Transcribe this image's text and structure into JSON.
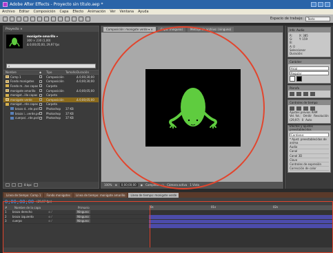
{
  "app": {
    "title": "Adobe After Effects - Proyecto sin título.aep *"
  },
  "menu": [
    "Archivo",
    "Editar",
    "Composición",
    "Capa",
    "Efecto",
    "Animación",
    "Ver",
    "Ventana",
    "Ayuda"
  ],
  "toolbar": {
    "workspace_label": "Espacio de trabajo:",
    "workspace_value": "Texto"
  },
  "project": {
    "tab": "Proyecto ×",
    "selected_name": "monigote-amarillo ▾",
    "selected_size": "300 × 230 (1,00)",
    "selected_duration": "Δ 0;00;05;00, 29,97 fps",
    "columns": [
      "Nombre",
      "Tipo",
      "Tamaño",
      "Duración"
    ],
    "items": [
      {
        "name": "Comp 1",
        "type": "Composición",
        "size": "",
        "duration": "Δ 0;00;30;00",
        "icon": "comp",
        "indent": false,
        "selected": false
      },
      {
        "name": "Fondo monigotes",
        "type": "Composición",
        "size": "",
        "duration": "Δ 0;00;30;00",
        "icon": "comp",
        "indent": false,
        "selected": false
      },
      {
        "name": "Fondo m...tos capas",
        "type": "Carpeta",
        "size": "",
        "duration": "",
        "icon": "folder",
        "indent": false,
        "selected": false
      },
      {
        "name": "monigote amarillo",
        "type": "Composición",
        "size": "",
        "duration": "Δ 0;00;05;00",
        "icon": "comp",
        "indent": false,
        "selected": false
      },
      {
        "name": "monigot...illo capas",
        "type": "Carpeta",
        "size": "",
        "duration": "",
        "icon": "folder",
        "indent": false,
        "selected": false
      },
      {
        "name": "monigote verde",
        "type": "Composición",
        "size": "",
        "duration": "Δ 0;00;05;00",
        "icon": "comp",
        "indent": false,
        "selected": true
      },
      {
        "name": "monigot...rde capas",
        "type": "Carpeta",
        "size": "",
        "duration": "",
        "icon": "folder",
        "indent": false,
        "selected": false
      },
      {
        "name": "brazo d...rde.psd",
        "type": "Photoshop",
        "size": "37 KB",
        "duration": "",
        "icon": "psd",
        "indent": true,
        "selected": false
      },
      {
        "name": "brazo i...verde.psd",
        "type": "Photoshop",
        "size": "37 KB",
        "duration": "",
        "icon": "psd",
        "indent": true,
        "selected": false
      },
      {
        "name": "cuerpo/...rde.psd",
        "type": "Photoshop",
        "size": "37 KB",
        "duration": "",
        "icon": "psd",
        "indent": true,
        "selected": false
      }
    ],
    "footer_bits": "8 bpc"
  },
  "comp": {
    "tabs": [
      {
        "label": "Composición: monigote verde ▾ ×",
        "active": true
      },
      {
        "label": "Capa: (ninguna)",
        "active": false
      },
      {
        "label": "Metraje de archivo: (ninguno)",
        "active": false
      }
    ],
    "zoom": "100%",
    "timecode": "0;00;00;00",
    "resolution": "Completa",
    "camera": "Cámara activa",
    "view": "1 Vista"
  },
  "right": {
    "info_tab": "Info",
    "audio_tab": "Audio",
    "info_lines": [
      "R:",
      "G:",
      "B:",
      "A: 0",
      "X: 385",
      "Y: 159"
    ],
    "info_footer": [
      "Seleccionar",
      "Duración:"
    ],
    "char_tab": "Carácter",
    "font": "Arial",
    "style": "Regular",
    "para_tab": "Párrafo",
    "anim_tab": "Controles de tiempo",
    "preview_label": "Ajustes previos RAM",
    "fps_label": "Vel. fot.:",
    "skip_label": "Omitir",
    "res_label": "Resolución",
    "fps_value": "(29,97)",
    "skip_value": "0",
    "res_value": "Auto",
    "fx_tab": "Efectos y ajustes preestablecidos",
    "fx_search": "Contiene:",
    "fx_items": [
      "* Ajust. preestablecidos de anima",
      "Audio",
      "Canal",
      "Canal 3D",
      "Clave",
      "Controles de expresión",
      "Corrección de color"
    ]
  },
  "timeline": {
    "tabs": [
      {
        "label": "Línea de tiempo: Comp 1",
        "active": false
      },
      {
        "label": "Fondo monigotes",
        "active": false
      },
      {
        "label": "Línea de tiempo: monigote amarillo",
        "active": false
      },
      {
        "label": "Línea de tiempo: monigote verde",
        "active": true
      }
    ],
    "time": "0;00;00;00",
    "fps": "(29,97 fps)",
    "columns": [
      "#",
      "Nombre de la capa",
      "Primario"
    ],
    "layers": [
      {
        "num": "1",
        "name": "brazo derecho",
        "parent": "Ninguno"
      },
      {
        "num": "2",
        "name": "brazo izquierdo",
        "parent": "Ninguno"
      },
      {
        "num": "3",
        "name": "cuerpo",
        "parent": "Ninguno"
      }
    ],
    "ruler": [
      "0s",
      "01s",
      "02s"
    ]
  }
}
